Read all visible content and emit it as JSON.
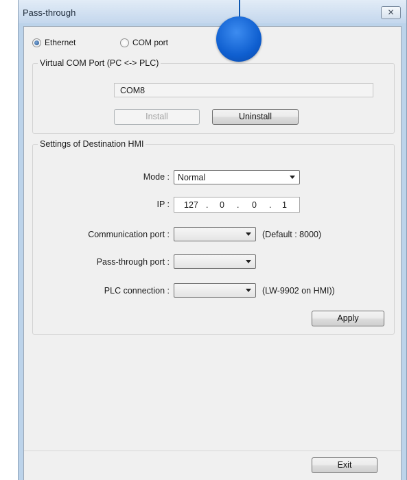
{
  "window": {
    "title": "Pass-through",
    "close_glyph": "✕"
  },
  "mode_radio": {
    "ethernet_label": "Ethernet",
    "com_label": "COM port",
    "selected": "Ethernet"
  },
  "virtual_com": {
    "legend": "Virtual COM Port (PC <-> PLC)",
    "port_value": "COM8",
    "install_label": "Install",
    "uninstall_label": "Uninstall"
  },
  "dest_hmi": {
    "legend": "Settings of Destination HMI",
    "mode_label": "Mode :",
    "mode_value": "Normal",
    "ip_label": "IP :",
    "ip": [
      "127",
      "0",
      "0",
      "1"
    ],
    "ip_sep": ".",
    "comm_port_label": "Communication port :",
    "comm_port_note": "(Default : 8000)",
    "passthrough_port_label": "Pass-through port :",
    "plc_conn_label": "PLC connection :",
    "plc_conn_note": "(LW-9902 on HMI))",
    "apply_label": "Apply"
  },
  "footer": {
    "exit_label": "Exit"
  },
  "colors": {
    "frame": "#bcd3ea",
    "client": "#f0f0f0",
    "marker": "#0f5fd0"
  }
}
